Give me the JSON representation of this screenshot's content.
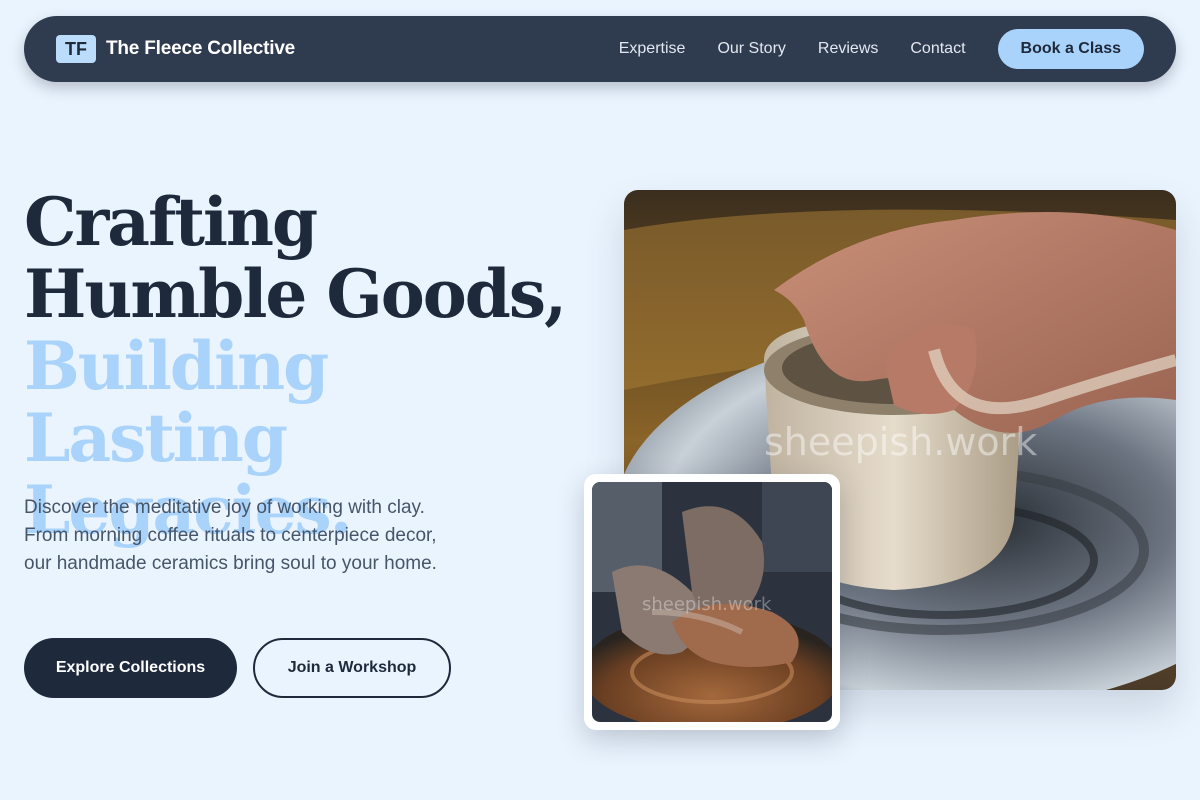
{
  "nav": {
    "logo_initials": "TF",
    "brand": "The Fleece Collective",
    "links": [
      "Expertise",
      "Our Story",
      "Reviews",
      "Contact"
    ],
    "cta": "Book a Class"
  },
  "hero": {
    "title_dark": [
      "Crafting",
      "Humble Goods,"
    ],
    "title_light": [
      "Building Lasting",
      "Legacies."
    ],
    "description": "Discover the meditative joy of working with clay. From morning coffee rituals to centerpiece decor, our handmade ceramics bring soul to your home.",
    "primary_button": "Explore Collections",
    "secondary_button": "Join a Workshop"
  },
  "images": {
    "main_watermark": "sheepish.work",
    "small_watermark": "sheepish.work"
  },
  "colors": {
    "background": "#eaf4fe",
    "nav": "#2f3b4f",
    "accent": "#a9d3fb",
    "dark": "#1e293b"
  }
}
